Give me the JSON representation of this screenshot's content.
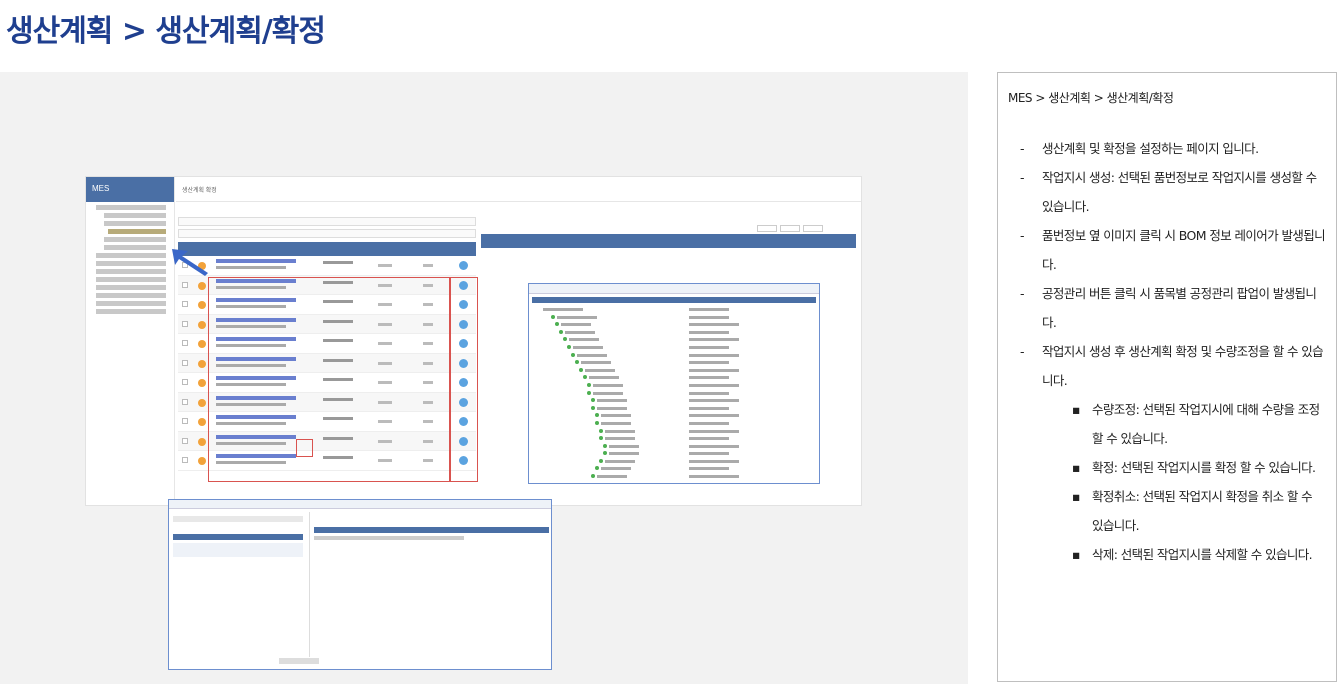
{
  "page_title": "생산계획 > 생산계획/확정",
  "app": {
    "logo": "MES",
    "header_title": "생산계획 확정"
  },
  "description": {
    "breadcrumb": "MES > 생산계획 > 생산계획/확정",
    "items": [
      {
        "text": "생산계획 및 확정을 설정하는 페이지 입니다."
      },
      {
        "text": "작업지시 생성: 선택된 품번정보로 작업지시를 생성할 수 있습니다."
      },
      {
        "text": "품번정보 옆 이미지 클릭 시 BOM 정보 레이어가 발생됩니다."
      },
      {
        "text": "공정관리 버튼 클릭 시 품목별 공정관리 팝업이 발생됩니다."
      },
      {
        "text": "작업지시 생성 후 생산계획 확정 및 수량조정을 할 수 있습니다."
      }
    ],
    "sub_items": [
      {
        "text": "수량조정: 선택된 작업지시에 대해 수량을 조정할 수 있습니다."
      },
      {
        "text": "확정: 선택된 작업지시를 확정 할 수 있습니다."
      },
      {
        "text": "확정취소: 선택된 작업지시 확정을 취소 할 수 있습니다."
      },
      {
        "text": "삭제: 선택된 작업지시를 삭제할 수 있습니다."
      }
    ]
  }
}
